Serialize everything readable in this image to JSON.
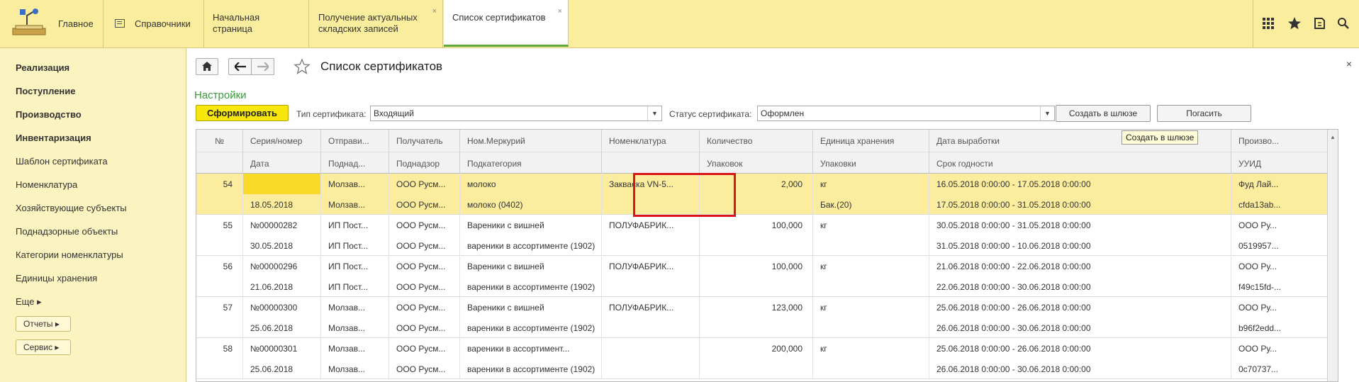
{
  "topbar": {
    "home_label": "Главное",
    "spr_label": "Справочники",
    "tabs": [
      {
        "label": "Начальная страница",
        "closable": false,
        "active": false
      },
      {
        "label": "Получение актуальных складских записей",
        "closable": true,
        "active": false
      },
      {
        "label": "Список сертификатов",
        "closable": true,
        "active": true
      }
    ],
    "close_glyph": "×",
    "icons": [
      "apps-grid-icon",
      "star-icon",
      "history-icon",
      "search-icon"
    ]
  },
  "sidebar": {
    "sections": [
      "Реализация",
      "Поступление",
      "Производство",
      "Инвентаризация"
    ],
    "items": [
      "Шаблон сертификата",
      "Номенклатура",
      "Хозяйствующие субъекты",
      "Поднадзорные объекты",
      "Категории номенклатуры",
      "Единицы хранения"
    ],
    "more": "Еще ▸",
    "reports": "Отчеты ▸",
    "service": "Сервис ▸"
  },
  "main": {
    "title": "Список сертификатов",
    "settings_link": "Настройки",
    "form_button": "Сформировать",
    "cert_type_label": "Тип сертификата:",
    "cert_type_value": "Входящий",
    "cert_status_label": "Статус сертификата:",
    "cert_status_value": "Оформлен",
    "create_gateway_button": "Создать в шлюзе",
    "extinguish_button": "Погасить",
    "tooltip": "Создать в шлюзе",
    "close_glyph": "×"
  },
  "table": {
    "headers_top": [
      "№",
      "Серия/номер",
      "Отправи...",
      "Получатель",
      "Ном.Меркурий",
      "Номенклатура",
      "Количество",
      "Единица хранения",
      "Дата выработки",
      "Произво..."
    ],
    "headers_bottom": [
      "",
      "Дата",
      "Поднад...",
      "Поднадзор",
      "Подкатегория",
      "",
      "Упаковок",
      "Упаковки",
      "Срок годности",
      "УУИД"
    ],
    "rows": [
      {
        "selected": true,
        "top": [
          "54",
          "",
          "Молзав...",
          "ООО Русм...",
          "молоко",
          "Закваска VN-5...",
          "2,000",
          "кг",
          "16.05.2018 0:00:00 - 17.05.2018 0:00:00",
          "Фуд Лай..."
        ],
        "bottom": [
          "",
          "18.05.2018",
          "Молзав...",
          "ООО Русм...",
          "молоко (0402)",
          "",
          "",
          "Бак.(20)",
          "17.05.2018 0:00:00 - 31.05.2018 0:00:00",
          "cfda13ab..."
        ]
      },
      {
        "selected": false,
        "top": [
          "55",
          "№00000282",
          "ИП Пост...",
          "ООО Русм...",
          "Вареники с вишней",
          "ПОЛУФАБРИК...",
          "100,000",
          "кг",
          "30.05.2018 0:00:00 - 31.05.2018 0:00:00",
          "ООО Ру..."
        ],
        "bottom": [
          "",
          "30.05.2018",
          "ИП Пост...",
          "ООО Русм...",
          "вареники в ассортименте (1902)",
          "",
          "",
          "",
          "31.05.2018 0:00:00 - 10.06.2018 0:00:00",
          "0519957..."
        ]
      },
      {
        "selected": false,
        "top": [
          "56",
          "№00000296",
          "ИП Пост...",
          "ООО Русм...",
          "Вареники с вишней",
          "ПОЛУФАБРИК...",
          "100,000",
          "кг",
          "21.06.2018 0:00:00 - 22.06.2018 0:00:00",
          "ООО Ру..."
        ],
        "bottom": [
          "",
          "21.06.2018",
          "ИП Пост...",
          "ООО Русм...",
          "вареники в ассортименте (1902)",
          "",
          "",
          "",
          "22.06.2018 0:00:00 - 30.06.2018 0:00:00",
          "f49c15fd-..."
        ]
      },
      {
        "selected": false,
        "top": [
          "57",
          "№00000300",
          "Молзав...",
          "ООО Русм...",
          "Вареники с вишней",
          "ПОЛУФАБРИК...",
          "123,000",
          "кг",
          "25.06.2018 0:00:00 - 26.06.2018 0:00:00",
          "ООО Ру..."
        ],
        "bottom": [
          "",
          "25.06.2018",
          "Молзав...",
          "ООО Русм...",
          "вареники в ассортименте (1902)",
          "",
          "",
          "",
          "26.06.2018 0:00:00 - 30.06.2018 0:00:00",
          "b96f2edd..."
        ]
      },
      {
        "selected": false,
        "top": [
          "58",
          "№00000301",
          "Молзав...",
          "ООО Русм...",
          "вареники в ассортимент...",
          "",
          "200,000",
          "кг",
          "25.06.2018 0:00:00 - 26.06.2018 0:00:00",
          "ООО Ру..."
        ],
        "bottom": [
          "",
          "25.06.2018",
          "Молзав...",
          "ООО Русм...",
          "вареники в ассортименте (1902)",
          "",
          "",
          "",
          "26.06.2018 0:00:00 - 30.06.2018 0:00:00",
          "0c70737..."
        ]
      }
    ]
  }
}
